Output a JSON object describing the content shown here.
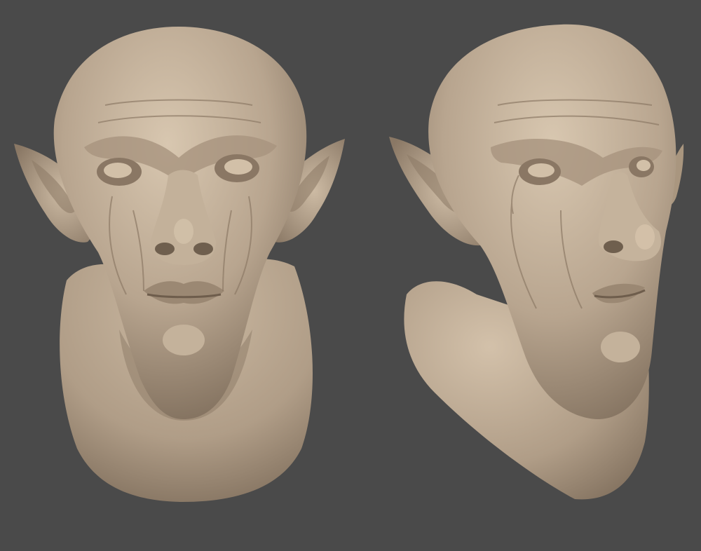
{
  "scene": {
    "background_color": "#4a4a4a",
    "material_color": "#b8a58f",
    "material_shadow": "#7d6c5a",
    "material_highlight": "#d8c7b0"
  },
  "views": [
    {
      "id": "front",
      "icon": "sculpt-bust-front"
    },
    {
      "id": "three-quarter",
      "icon": "sculpt-bust-three-quarter"
    }
  ]
}
